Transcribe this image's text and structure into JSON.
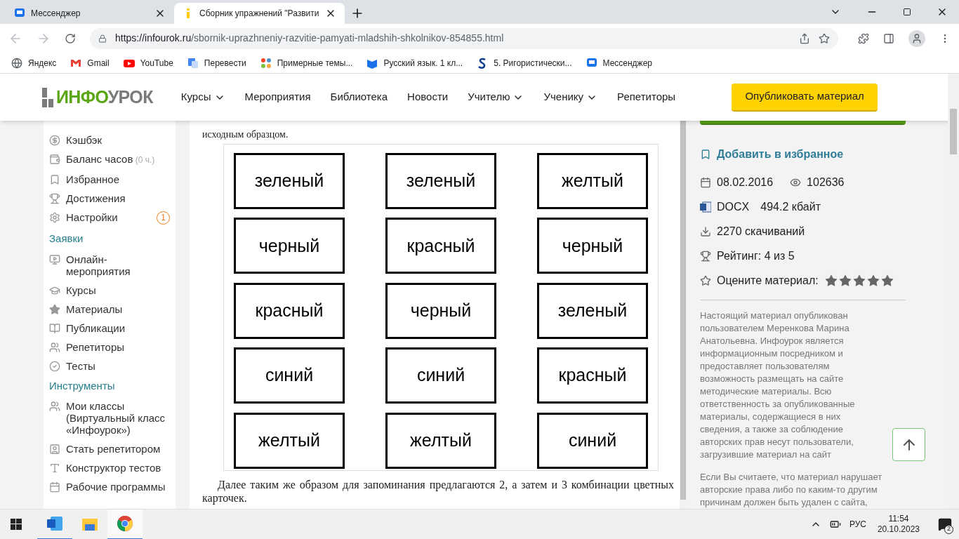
{
  "browser": {
    "tabs": [
      {
        "title": "Мессенджер",
        "selected": false
      },
      {
        "title": "Сборник упражнений \"Развити",
        "selected": true
      }
    ],
    "url_host": "https://infourok.ru",
    "url_path": "/sbornik-uprazhneniy-razvitie-pamyati-mladshih-shkolnikov-854855.html",
    "bookmarks": [
      "Яндекс",
      "Gmail",
      "YouTube",
      "Перевести",
      "Примерные темы...",
      "Русский язык. 1 кл...",
      "5. Ригористически...",
      "Мессенджер"
    ]
  },
  "header": {
    "logo_a": "ИНФО",
    "logo_b": "УРОК",
    "nav": [
      {
        "label": "Курсы",
        "dropdown": true
      },
      {
        "label": "Мероприятия",
        "dropdown": false
      },
      {
        "label": "Библиотека",
        "dropdown": false
      },
      {
        "label": "Новости",
        "dropdown": false
      },
      {
        "label": "Учителю",
        "dropdown": true
      },
      {
        "label": "Ученику",
        "dropdown": true
      },
      {
        "label": "Репетиторы",
        "dropdown": false
      }
    ],
    "publish_button": "Опубликовать материал"
  },
  "sidebar": {
    "sections": [
      {
        "items": [
          {
            "label": "Кэшбэк"
          },
          {
            "label": "Баланс часов",
            "note": "(0 ч.)"
          },
          {
            "label": "Избранное"
          },
          {
            "label": "Достижения"
          },
          {
            "label": "Настройки",
            "badge": "1"
          }
        ]
      },
      {
        "title": "Заявки",
        "items": [
          {
            "label": "Онлайн-мероприятия"
          },
          {
            "label": "Курсы"
          },
          {
            "label": "Материалы"
          },
          {
            "label": "Публикации"
          },
          {
            "label": "Репетиторы"
          },
          {
            "label": "Тесты"
          }
        ]
      },
      {
        "title": "Инструменты",
        "items": [
          {
            "label": "Мои классы (Виртуальный класс «Инфоурок»)"
          },
          {
            "label": "Стать репетитором"
          },
          {
            "label": "Конструктор тестов"
          },
          {
            "label": "Рабочие программы"
          }
        ]
      }
    ]
  },
  "document": {
    "text_top": "исходным образцом.",
    "cards": [
      [
        "зеленый",
        "зеленый",
        "желтый"
      ],
      [
        "черный",
        "красный",
        "черный"
      ],
      [
        "красный",
        "черный",
        "зеленый"
      ],
      [
        "синий",
        "синий",
        "красный"
      ],
      [
        "желтый",
        "желтый",
        "синий"
      ]
    ],
    "text_bottom": "Далее таким же образом для запоминания предлагаются 2, а затем и 3 комбинации цветных карточек."
  },
  "info": {
    "favorite": "Добавить в избранное",
    "date": "08.02.2016",
    "views": "102636",
    "format": "DOCX",
    "size": "494.2 кбайт",
    "downloads": "2270 скачиваний",
    "rating": "Рейтинг: 4 из 5",
    "rate_label": "Оцените материал:",
    "disclaimer": "Настоящий материал опубликован пользователем Меренкова Марина Анатольевна. Инфоурок является информационным посредником и предоставляет пользователям возможность размещать на сайте методические материалы. Всю ответственность за опубликованные материалы, содержащиеся в них сведения, а также за соблюдение авторских прав несут пользователи, загрузившие материал на сайт",
    "notice": "Если Вы считаете, что материал нарушает авторские права либо по каким-то другим причинам должен быть удален с сайта,"
  },
  "taskbar": {
    "language": "РУС",
    "time": "11:54",
    "date": "20.10.2023",
    "notifications": "2"
  }
}
